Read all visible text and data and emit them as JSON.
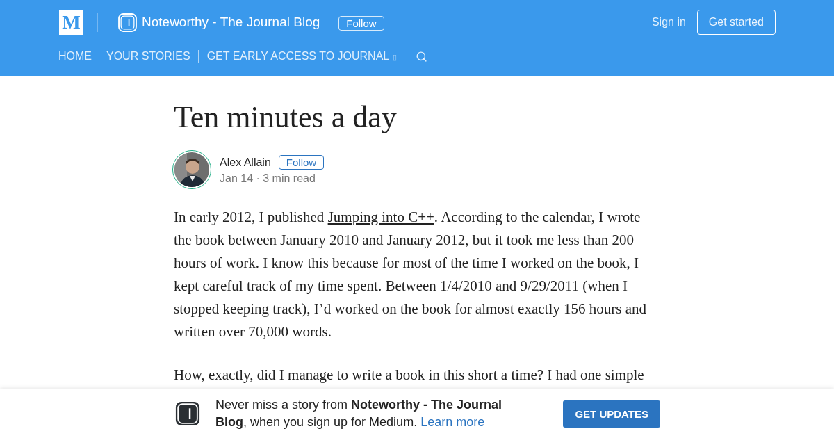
{
  "header": {
    "logo": "M",
    "publication": "Noteworthy - The Journal Blog",
    "follow": "Follow",
    "sign_in": "Sign in",
    "get_started": "Get started"
  },
  "nav": [
    {
      "label": "HOME",
      "divider_after": false
    },
    {
      "label": "YOUR STORIES",
      "divider_after": true
    },
    {
      "label": "GET EARLY ACCESS TO JOURNAL",
      "divider_after": false,
      "glyph": "▯"
    }
  ],
  "article": {
    "title": "Ten minutes a day",
    "author": "Alex Allain",
    "follow": "Follow",
    "meta": "Jan 14 · 3 min read",
    "paragraphs": [
      {
        "before": "In early 2012, I published ",
        "link": "Jumping into C++",
        "after": ". According to the calendar, I wrote the book between January 2010 and January 2012, but it took me less than 200 hours of work. I know this because for most of the time I worked on the book, I kept careful track of my time spent. Between 1/4/2010 and 9/29/2011 (when I stopped keeping track), I’d worked on the book for almost exactly 156 hours and written over 70,000 words."
      },
      {
        "before": "How, exactly, did I manage to write a book in this short a time? I had one simple"
      }
    ]
  },
  "banner": {
    "text": "Never miss a story from **Noteworthy - The Journal Blog**, when you sign up for Medium.",
    "link": "Learn more",
    "button": "GET UPDATES"
  }
}
